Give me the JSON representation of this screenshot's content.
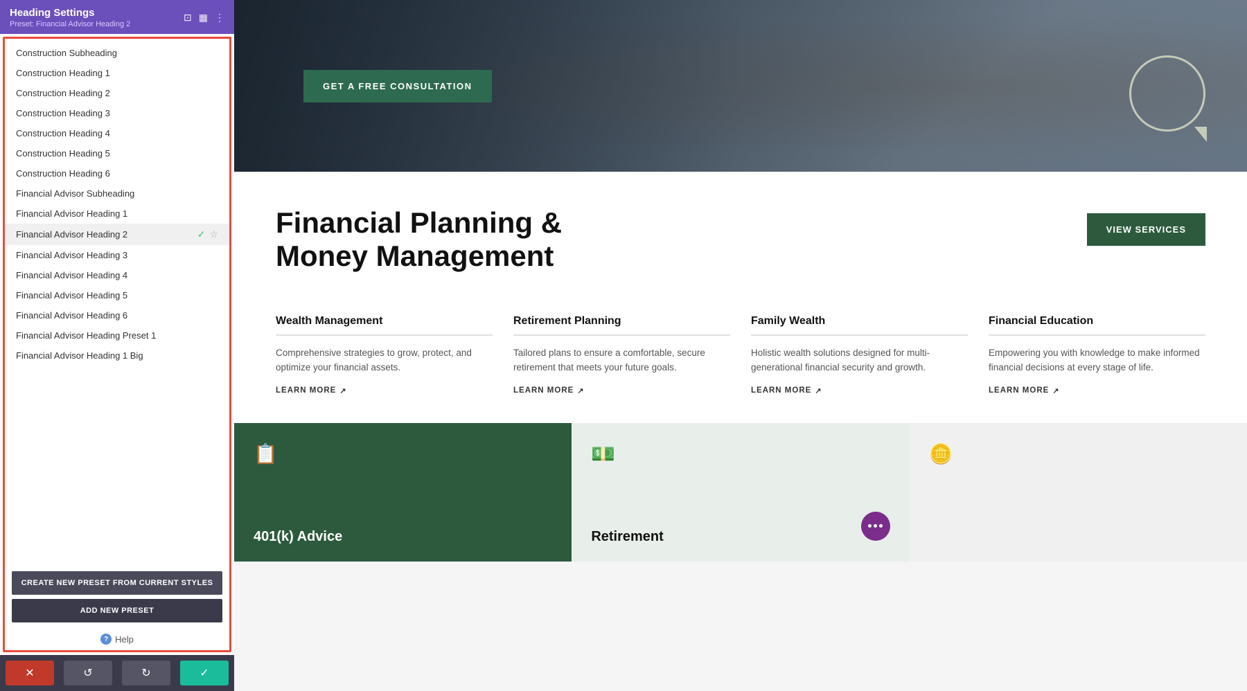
{
  "panel": {
    "title": "Heading Settings",
    "preset_label": "Preset: Financial Advisor Heading 2",
    "preset_dropdown_arrow": "▾"
  },
  "presets": [
    {
      "id": 1,
      "label": "Construction Subheading",
      "active": false,
      "checkmark": false,
      "star": false
    },
    {
      "id": 2,
      "label": "Construction Heading 1",
      "active": false,
      "checkmark": false,
      "star": false
    },
    {
      "id": 3,
      "label": "Construction Heading 2",
      "active": false,
      "checkmark": false,
      "star": false
    },
    {
      "id": 4,
      "label": "Construction Heading 3",
      "active": false,
      "checkmark": false,
      "star": false
    },
    {
      "id": 5,
      "label": "Construction Heading 4",
      "active": false,
      "checkmark": false,
      "star": false
    },
    {
      "id": 6,
      "label": "Construction Heading 5",
      "active": false,
      "checkmark": false,
      "star": false
    },
    {
      "id": 7,
      "label": "Construction Heading 6",
      "active": false,
      "checkmark": false,
      "star": false
    },
    {
      "id": 8,
      "label": "Financial Advisor Subheading",
      "active": false,
      "checkmark": false,
      "star": false
    },
    {
      "id": 9,
      "label": "Financial Advisor Heading 1",
      "active": false,
      "checkmark": false,
      "star": false
    },
    {
      "id": 10,
      "label": "Financial Advisor Heading 2",
      "active": true,
      "checkmark": true,
      "star": true
    },
    {
      "id": 11,
      "label": "Financial Advisor Heading 3",
      "active": false,
      "checkmark": false,
      "star": false
    },
    {
      "id": 12,
      "label": "Financial Advisor Heading 4",
      "active": false,
      "checkmark": false,
      "star": false
    },
    {
      "id": 13,
      "label": "Financial Advisor Heading 5",
      "active": false,
      "checkmark": false,
      "star": false
    },
    {
      "id": 14,
      "label": "Financial Advisor Heading 6",
      "active": false,
      "checkmark": false,
      "star": false
    },
    {
      "id": 15,
      "label": "Financial Advisor Heading Preset 1",
      "active": false,
      "checkmark": false,
      "star": false
    },
    {
      "id": 16,
      "label": "Financial Advisor Heading 1 Big",
      "active": false,
      "checkmark": false,
      "star": false
    }
  ],
  "buttons": {
    "create_preset": "CREATE NEW PRESET FROM CURRENT STYLES",
    "add_preset": "ADD NEW PRESET",
    "help": "Help",
    "cancel": "✕",
    "undo": "↺",
    "redo": "↻",
    "save": "✓"
  },
  "hero": {
    "cta_button": "GET A FREE CONSULTATION"
  },
  "main": {
    "heading_line1": "Financial Planning &",
    "heading_line2": "Money Management",
    "view_services": "VIEW SERVICES"
  },
  "services": [
    {
      "title": "Wealth Management",
      "desc": "Comprehensive strategies to grow, protect, and optimize your financial assets.",
      "learn_more": "LEARN MORE"
    },
    {
      "title": "Retirement Planning",
      "desc": "Tailored plans to ensure a comfortable, secure retirement that meets your future goals.",
      "learn_more": "LEARN MORE"
    },
    {
      "title": "Family Wealth",
      "desc": "Holistic wealth solutions designed for multi-generational financial security and growth.",
      "learn_more": "LEARN MORE"
    },
    {
      "title": "Financial Education",
      "desc": "Empowering you with knowledge to make informed financial decisions at every stage of life.",
      "learn_more": "LEARN MORE"
    }
  ],
  "cards": [
    {
      "title": "401(k) Advice",
      "icon": "📄",
      "bg": "dark"
    },
    {
      "title": "Retirement",
      "icon": "💰",
      "bg": "light"
    },
    {
      "title": "",
      "icon": "🪙",
      "bg": "gray"
    }
  ]
}
